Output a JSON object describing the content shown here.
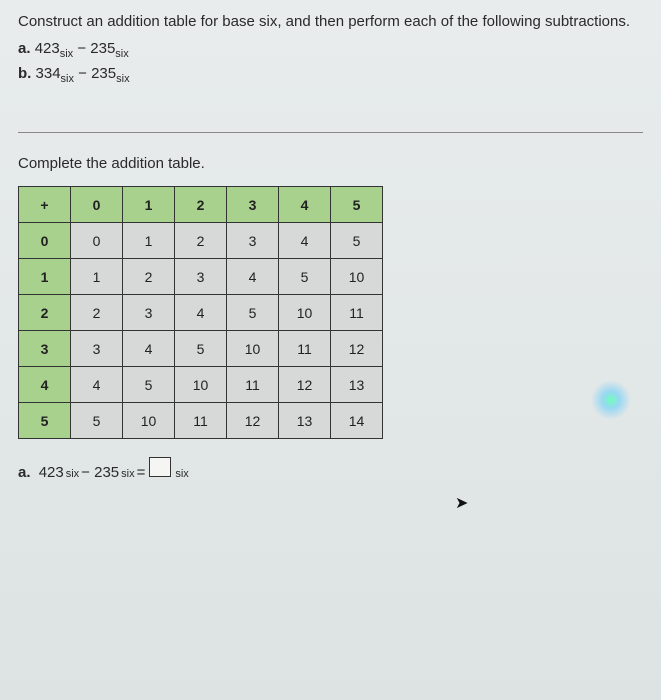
{
  "problem": {
    "intro": "Construct an addition table for base six, and then perform each of the following subtractions.",
    "a_label": "a.",
    "a_lhs": "423",
    "a_sub": "six",
    "a_op": " − 235",
    "b_label": "b.",
    "b_lhs": "334",
    "b_sub": "six",
    "b_op": " − 235"
  },
  "instruction": "Complete the addition table.",
  "table": {
    "corner": "+",
    "col_headers": [
      "0",
      "1",
      "2",
      "3",
      "4",
      "5"
    ],
    "row_headers": [
      "0",
      "1",
      "2",
      "3",
      "4",
      "5"
    ],
    "rows": [
      [
        "0",
        "1",
        "2",
        "3",
        "4",
        "5"
      ],
      [
        "1",
        "2",
        "3",
        "4",
        "5",
        "10"
      ],
      [
        "2",
        "3",
        "4",
        "5",
        "10",
        "11"
      ],
      [
        "3",
        "4",
        "5",
        "10",
        "11",
        "12"
      ],
      [
        "4",
        "5",
        "10",
        "11",
        "12",
        "13"
      ],
      [
        "5",
        "10",
        "11",
        "12",
        "13",
        "14"
      ]
    ]
  },
  "answer": {
    "label": "a.",
    "lhs": "423",
    "sub": "six",
    "op": " − 235",
    "eq": " = ",
    "rsub": "six"
  },
  "chart_data": {
    "type": "table",
    "title": "Base six addition table",
    "columns": [
      "+",
      "0",
      "1",
      "2",
      "3",
      "4",
      "5"
    ],
    "rows": [
      [
        "0",
        "0",
        "1",
        "2",
        "3",
        "4",
        "5"
      ],
      [
        "1",
        "1",
        "2",
        "3",
        "4",
        "5",
        "10"
      ],
      [
        "2",
        "2",
        "3",
        "4",
        "5",
        "10",
        "11"
      ],
      [
        "3",
        "3",
        "4",
        "5",
        "10",
        "11",
        "12"
      ],
      [
        "4",
        "4",
        "5",
        "10",
        "11",
        "12",
        "13"
      ],
      [
        "5",
        "5",
        "10",
        "11",
        "12",
        "13",
        "14"
      ]
    ]
  }
}
